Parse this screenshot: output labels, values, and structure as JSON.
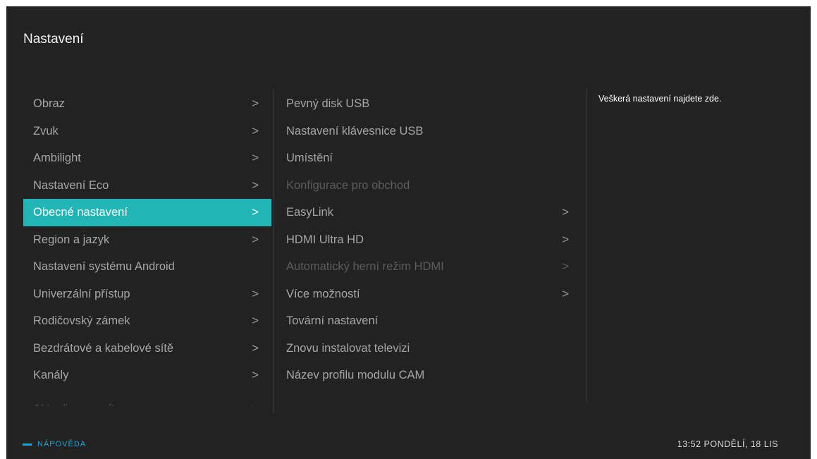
{
  "header": {
    "title": "Nastavení"
  },
  "main_menu": [
    {
      "label": "Obraz",
      "chevron": ">"
    },
    {
      "label": "Zvuk",
      "chevron": ">"
    },
    {
      "label": "Ambilight",
      "chevron": ">"
    },
    {
      "label": "Nastavení Eco",
      "chevron": ">"
    },
    {
      "label": "Obecné nastavení",
      "chevron": ">"
    },
    {
      "label": "Region a jazyk",
      "chevron": ">"
    },
    {
      "label": "Nastavení systému Android",
      "chevron": ""
    },
    {
      "label": "Univerzální přístup",
      "chevron": ">"
    },
    {
      "label": "Rodičovský zámek",
      "chevron": ">"
    },
    {
      "label": "Bezdrátové a kabelové sítě",
      "chevron": ">"
    },
    {
      "label": "Kanály",
      "chevron": ">"
    },
    {
      "label": "Aktualizace softwaru",
      "chevron": ">"
    }
  ],
  "sub_menu": [
    {
      "label": "Pevný disk USB",
      "chevron": ""
    },
    {
      "label": "Nastavení klávesnice USB",
      "chevron": ""
    },
    {
      "label": "Umístění",
      "chevron": ""
    },
    {
      "label": "Konfigurace pro obchod",
      "chevron": ""
    },
    {
      "label": "EasyLink",
      "chevron": ">"
    },
    {
      "label": "HDMI Ultra HD",
      "chevron": ">"
    },
    {
      "label": "Automatický herní režim HDMI",
      "chevron": ">"
    },
    {
      "label": "Více možností",
      "chevron": ">"
    },
    {
      "label": "Tovární nastavení",
      "chevron": ""
    },
    {
      "label": "Znovu instalovat televizi",
      "chevron": ""
    },
    {
      "label": "Název profilu modulu CAM",
      "chevron": ""
    }
  ],
  "info_panel": {
    "text": "Veškerá nastavení najdete zde."
  },
  "footer": {
    "help_label": "NÁPOVĚDA",
    "datetime": "13:52 PONDĚLÍ, 18 LIS"
  },
  "colors": {
    "background": "#222222",
    "selection": "#21b5b5",
    "help_accent": "#1aa7d8"
  }
}
